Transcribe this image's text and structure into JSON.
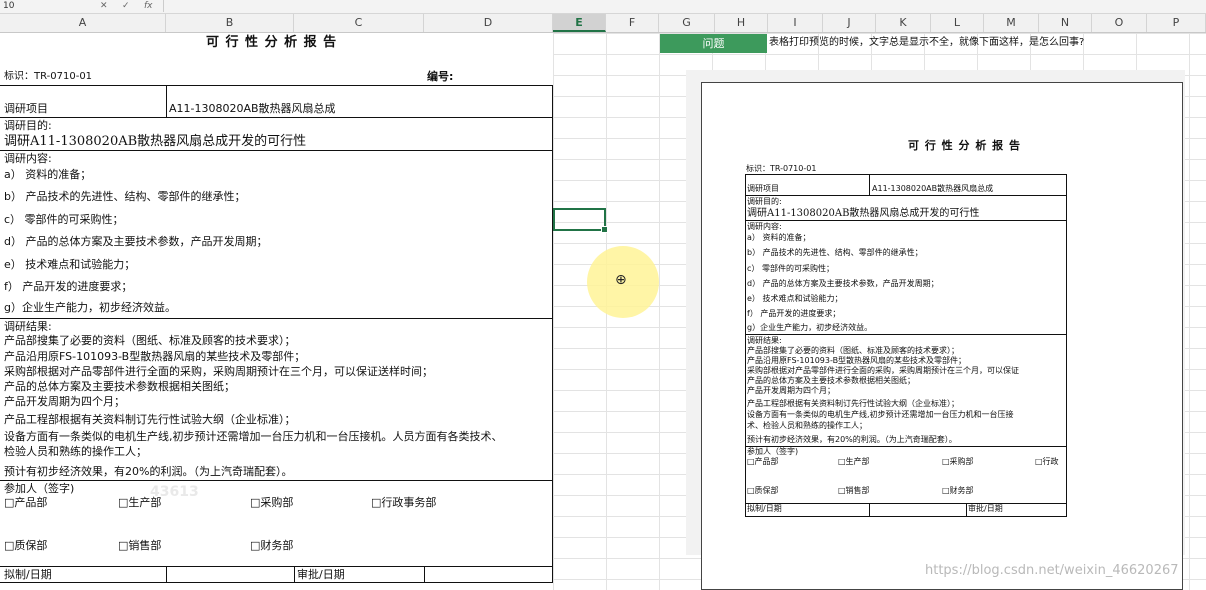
{
  "toolbar": {
    "cell_ref": "10",
    "cancel": "✕",
    "confirm": "✓",
    "fx": "fx"
  },
  "columns": [
    "A",
    "B",
    "C",
    "D",
    "E",
    "F",
    "G",
    "H",
    "I",
    "J",
    "K",
    "L",
    "M",
    "N",
    "O",
    "P"
  ],
  "selected_column": "E",
  "sheet": {
    "title": "可 行 性 分 析 报 告",
    "id_label": "标识：TR-0710-01",
    "number_label": "编号:",
    "project_label": "调研项目",
    "project_value": "A11-1308020AB散热器风扇总成",
    "purpose_label": "调研目的:",
    "purpose_value": "调研A11-1308020AB散热器风扇总成开发的可行性",
    "content_label": "调研内容:",
    "content_items": [
      "a）  资料的准备；",
      "b）  产品技术的先进性、结构、零部件的继承性；",
      "c）  零部件的可采购性；",
      "d）  产品的总体方案及主要技术参数，产品开发周期；",
      "e）  技术难点和试验能力；",
      "f）  产品开发的进度要求；",
      "g）企业生产能力，初步经济效益。"
    ],
    "result_label": "调研结果:",
    "result_lines": [
      "产品部搜集了必要的资料（图纸、标准及顾客的技术要求）；",
      "产品沿用原FS-101093-B型散热器风扇的某些技术及零部件；",
      "采购部根据对产品零部件进行全面的采购，采购周期预计在三个月，可以保证送样时间；",
      "产品的总体方案及主要技术参数根据相关图纸；",
      "产品开发周期为四个月；",
      "产品工程部根据有关资料制订先行性试验大纲（企业标准）；",
      "设备方面有一条类似的电机生产线,初步预计还需增加一台压力机和一台压接机。人员方面有各类技术、",
      "检验人员和熟练的操作工人；",
      "预计有初步经济效果，有20%的利润。（为上汽奇瑞配套）。"
    ],
    "participants_label": "参加人（签字)",
    "departments": [
      "□产品部",
      "□生产部",
      "□采购部",
      "□行政事务部",
      "□质保部",
      "□销售部",
      "□财务部"
    ],
    "draft_label": "拟制/日期",
    "approve_label": "审批/日期"
  },
  "question": {
    "label": "问题",
    "text": "表格打印预览的时候，文字总是显示不全，就像下面这样，是怎么回事?"
  },
  "preview": {
    "title": "可 行 性 分 析 报 告",
    "id_label": "标识：TR-0710-01",
    "project_label": "调研项目",
    "project_value": "A11-1308020AB散热器风扇总成",
    "purpose_label": "调研目的:",
    "purpose_value": "调研A11-1308020AB散热器风扇总成开发的可行性",
    "content_label": "调研内容:",
    "content_items": [
      "a）  资料的准备；",
      "b）  产品技术的先进性、结构、零部件的继承性；",
      "c）  零部件的可采购性；",
      "d）  产品的总体方案及主要技术参数，产品开发周期；",
      "e）  技术难点和试验能力；",
      "f）  产品开发的进度要求；",
      "g）企业生产能力，初步经济效益。"
    ],
    "result_label": "调研结果:",
    "result_lines": [
      "产品部搜集了必要的资料（图纸、标准及顾客的技术要求）；",
      "产品沿用原FS-101093-B型散热器风扇的某些技术及零部件；",
      "采购部根据对产品零部件进行全面的采购，采购周期预计在三个月，可以保证",
      "产品的总体方案及主要技术参数根据相关图纸；",
      "产品开发周期为四个月；",
      "产品工程部根据有关资料制订先行性试验大纲（企业标准）；",
      "设备方面有一条类似的电机生产线,初步预计还需增加一台压力机和一台压接",
      "术、检验人员和熟练的操作工人；",
      "预计有初步经济效果，有20%的利润。（为上汽奇瑞配套）。"
    ],
    "participants_label": "参加人（签字)",
    "departments": [
      "□产品部",
      "□生产部",
      "□采购部",
      "□行政",
      "□质保部",
      "□销售部",
      "□财务部"
    ],
    "draft_label": "拟制/日期",
    "approve_label": "审批/日期"
  },
  "watermark": "https://blog.csdn.net/weixin_46620267",
  "faint_text": "43613"
}
